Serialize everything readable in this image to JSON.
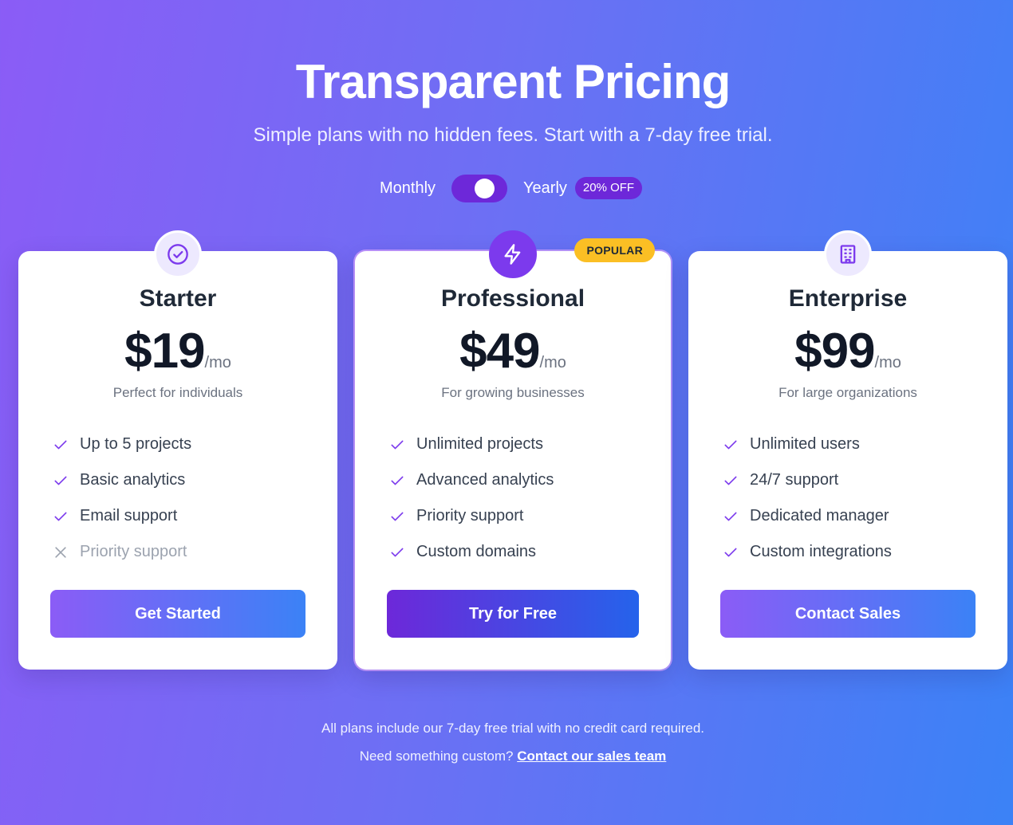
{
  "header": {
    "title": "Transparent Pricing",
    "subtitle": "Simple plans with no hidden fees. Start with a 7-day free trial."
  },
  "billing": {
    "monthly_label": "Monthly",
    "yearly_label": "Yearly",
    "discount_badge": "20% OFF",
    "toggle_state": "yearly"
  },
  "plans": [
    {
      "name": "Starter",
      "icon": "check-circle-icon",
      "price": "$19",
      "period": "/mo",
      "tagline": "Perfect for individuals",
      "features": [
        {
          "label": "Up to 5 projects",
          "included": true
        },
        {
          "label": "Basic analytics",
          "included": true
        },
        {
          "label": "Email support",
          "included": true
        },
        {
          "label": "Priority support",
          "included": false
        }
      ],
      "cta": "Get Started"
    },
    {
      "name": "Professional",
      "icon": "lightning-icon",
      "badge": "POPULAR",
      "price": "$49",
      "period": "/mo",
      "tagline": "For growing businesses",
      "features": [
        {
          "label": "Unlimited projects",
          "included": true
        },
        {
          "label": "Advanced analytics",
          "included": true
        },
        {
          "label": "Priority support",
          "included": true
        },
        {
          "label": "Custom domains",
          "included": true
        }
      ],
      "cta": "Try for Free"
    },
    {
      "name": "Enterprise",
      "icon": "building-icon",
      "price": "$99",
      "period": "/mo",
      "tagline": "For large organizations",
      "features": [
        {
          "label": "Unlimited users",
          "included": true
        },
        {
          "label": "24/7 support",
          "included": true
        },
        {
          "label": "Dedicated manager",
          "included": true
        },
        {
          "label": "Custom integrations",
          "included": true
        }
      ],
      "cta": "Contact Sales"
    }
  ],
  "footer": {
    "note": "All plans include our 7-day free trial with no credit card required.",
    "custom_prompt": "Need something custom?",
    "contact_link": "Contact our sales team"
  },
  "colors": {
    "accent": "#7c3aed",
    "gradient_start": "#8b5cf6",
    "gradient_end": "#3b82f6",
    "popular_badge": "#fbbf24"
  }
}
